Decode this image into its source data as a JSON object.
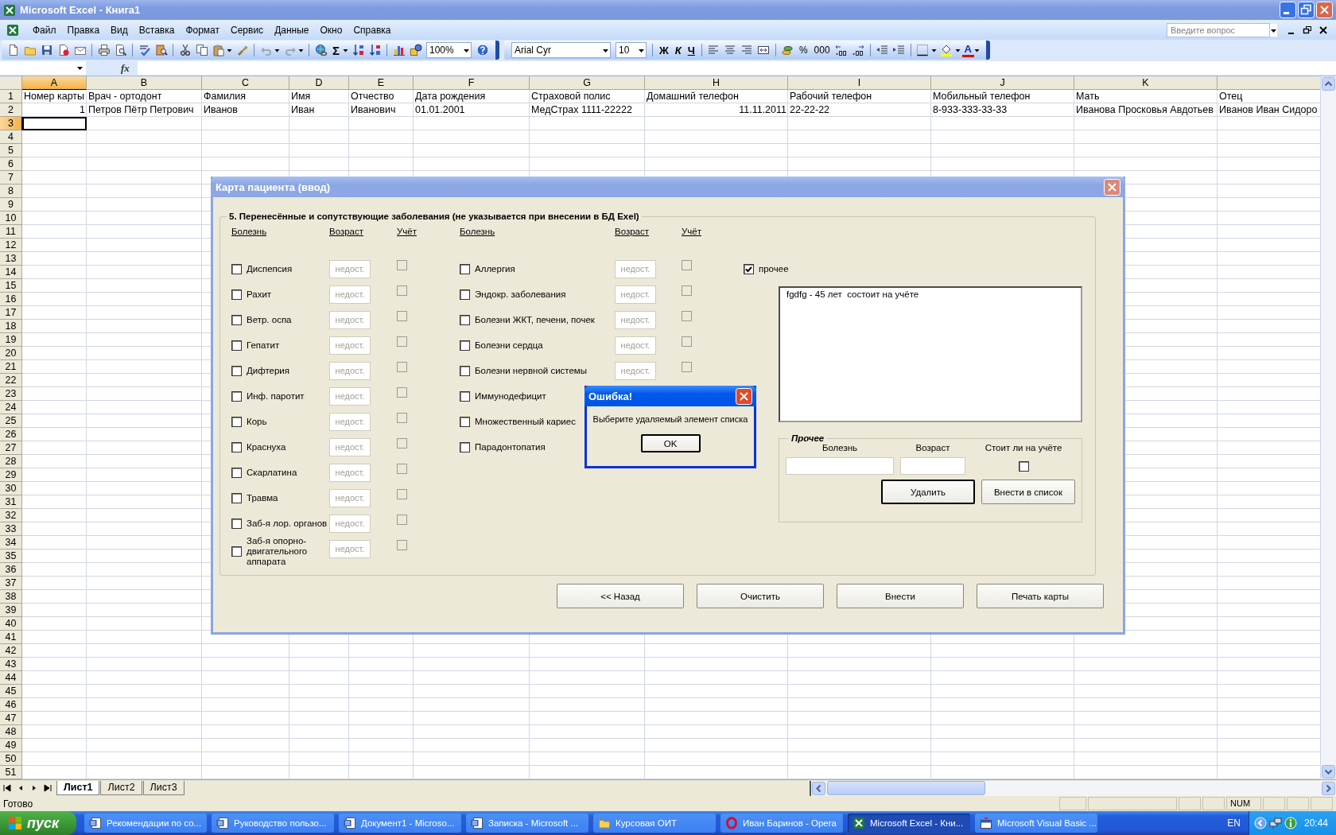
{
  "window": {
    "title": "Microsoft Excel - Книга1",
    "active": false
  },
  "menu": [
    "Файл",
    "Правка",
    "Вид",
    "Вставка",
    "Формат",
    "Сервис",
    "Данные",
    "Окно",
    "Справка"
  ],
  "help_search": {
    "placeholder": "Введите вопрос"
  },
  "toolbar": {
    "sum": "Σ",
    "zoom": "100%",
    "font": "Arial Cyr",
    "size": "10",
    "style_buttons": [
      {
        "label": "Ж",
        "kind": "bold"
      },
      {
        "label": "К",
        "kind": "italic"
      },
      {
        "label": "Ч",
        "kind": "underline"
      }
    ],
    "number_buttons": [
      "%",
      "000"
    ],
    "font_color": "A"
  },
  "formula_bar": {
    "fx": "fx"
  },
  "sheet": {
    "columns": [
      {
        "header": "A",
        "selected": true
      },
      {
        "header": "B",
        "selected": false
      },
      {
        "header": "C",
        "selected": false
      },
      {
        "header": "D",
        "selected": false
      },
      {
        "header": "E",
        "selected": false
      },
      {
        "header": "F",
        "selected": false
      },
      {
        "header": "G",
        "selected": false
      },
      {
        "header": "H",
        "selected": false
      },
      {
        "header": "I",
        "selected": false
      },
      {
        "header": "J",
        "selected": false
      },
      {
        "header": "K",
        "selected": false
      },
      {
        "selected": false
      }
    ],
    "rows": [
      {
        "header": "1",
        "selected": false,
        "cells": [
          {
            "text": "Номер карты",
            "kind": "text"
          },
          {
            "text": "Врач - ортодонт",
            "kind": "text"
          },
          {
            "text": "Фамилия",
            "kind": "text"
          },
          {
            "text": "Имя",
            "kind": "text"
          },
          {
            "text": "Отчество",
            "kind": "text"
          },
          {
            "text": "Дата рождения",
            "kind": "text"
          },
          {
            "text": "Страховой полис",
            "kind": "text"
          },
          {
            "text": "Домашний телефон",
            "kind": "text"
          },
          {
            "text": "Рабочий телефон",
            "kind": "text"
          },
          {
            "text": "Мобильный телефон",
            "kind": "text"
          },
          {
            "text": "Мать",
            "kind": "text"
          },
          {
            "text": "Отец",
            "kind": "text"
          }
        ]
      },
      {
        "header": "2",
        "selected": false,
        "cells": [
          {
            "text": "1",
            "kind": "number"
          },
          {
            "text": "Петров Пётр Петрович",
            "kind": "text"
          },
          {
            "text": "Иванов",
            "kind": "text"
          },
          {
            "text": "Иван",
            "kind": "text"
          },
          {
            "text": "Иванович",
            "kind": "text"
          },
          {
            "text": "01.01.2001",
            "kind": "text"
          },
          {
            "text": "МедСтрах 1111-22222",
            "kind": "text"
          },
          {
            "text": "11.11.2011",
            "kind": "number"
          },
          {
            "text": "22-22-22",
            "kind": "text"
          },
          {
            "text": "8-933-333-33-33",
            "kind": "text"
          },
          {
            "text": "Иванова Просковья Авдотьев",
            "kind": "text"
          },
          {
            "text": "Иванов Иван Сидоро",
            "kind": "text"
          }
        ]
      },
      {
        "header": "3",
        "selected": true
      },
      {
        "header": "4",
        "selected": false
      },
      {
        "header": "5",
        "selected": false
      },
      {
        "header": "6",
        "selected": false
      },
      {
        "header": "7",
        "selected": false
      },
      {
        "header": "8",
        "selected": false
      },
      {
        "header": "9",
        "selected": false
      },
      {
        "header": "10",
        "selected": false
      },
      {
        "header": "11",
        "selected": false
      },
      {
        "header": "12",
        "selected": false
      },
      {
        "header": "13",
        "selected": false
      },
      {
        "header": "14",
        "selected": false
      },
      {
        "header": "15",
        "selected": false
      },
      {
        "header": "16",
        "selected": false
      },
      {
        "header": "17",
        "selected": false
      },
      {
        "header": "18",
        "selected": false
      },
      {
        "header": "19",
        "selected": false
      },
      {
        "header": "20",
        "selected": false
      },
      {
        "header": "21",
        "selected": false
      },
      {
        "header": "22",
        "selected": false
      },
      {
        "header": "23",
        "selected": false
      },
      {
        "header": "24",
        "selected": false
      },
      {
        "header": "25",
        "selected": false
      },
      {
        "header": "26",
        "selected": false
      },
      {
        "header": "27",
        "selected": false
      },
      {
        "header": "28",
        "selected": false
      },
      {
        "header": "29",
        "selected": false
      },
      {
        "header": "30",
        "selected": false
      },
      {
        "header": "31",
        "selected": false
      },
      {
        "header": "32",
        "selected": false
      },
      {
        "header": "33",
        "selected": false
      },
      {
        "header": "34",
        "selected": false
      },
      {
        "header": "35",
        "selected": false
      },
      {
        "header": "36",
        "selected": false
      },
      {
        "header": "37",
        "selected": false
      },
      {
        "header": "38",
        "selected": false
      },
      {
        "header": "39",
        "selected": false
      },
      {
        "header": "40",
        "selected": false
      },
      {
        "header": "41",
        "selected": false
      },
      {
        "header": "42",
        "selected": false
      },
      {
        "header": "43",
        "selected": false
      },
      {
        "header": "44",
        "selected": false
      },
      {
        "header": "45",
        "selected": false
      },
      {
        "header": "46",
        "selected": false
      },
      {
        "header": "47",
        "selected": false
      },
      {
        "header": "48",
        "selected": false
      },
      {
        "header": "49",
        "selected": false
      },
      {
        "header": "50",
        "selected": false
      },
      {
        "header": "51",
        "selected": false
      }
    ]
  },
  "sheet_tabs": [
    {
      "label": "Лист1",
      "selected": true
    },
    {
      "label": "Лист2",
      "selected": false
    },
    {
      "label": "Лист3",
      "selected": false
    }
  ],
  "status_bar": {
    "text": "Готово",
    "indicators": [
      "NUM"
    ]
  },
  "patient_form": {
    "title": "Карта пациента (ввод)",
    "active": false,
    "legend": "5. Перенесённые и сопутствующие заболевания (не указывается при внесении в БД Exel)",
    "columns": [
      {
        "headers": [
          "Болезнь",
          "Возраст",
          "Учёт"
        ],
        "items": [
          {
            "label": "Диспепсия",
            "checked": false,
            "age": "недост.",
            "age_disabled": true,
            "registered": false
          },
          {
            "label": "Рахит",
            "checked": false,
            "age": "недост.",
            "age_disabled": true,
            "registered": false
          },
          {
            "label": "Ветр. оспа",
            "checked": false,
            "age": "недост.",
            "age_disabled": true,
            "registered": false
          },
          {
            "label": "Гепатит",
            "checked": false,
            "age": "недост.",
            "age_disabled": true,
            "registered": false
          },
          {
            "label": "Дифтерия",
            "checked": false,
            "age": "недост.",
            "age_disabled": true,
            "registered": false
          },
          {
            "label": "Инф. паротит",
            "checked": false,
            "age": "недост.",
            "age_disabled": true,
            "registered": false
          },
          {
            "label": "Корь",
            "checked": false,
            "age": "недост.",
            "age_disabled": true,
            "registered": false
          },
          {
            "label": "Краснуха",
            "checked": false,
            "age": "недост.",
            "age_disabled": true,
            "registered": false
          },
          {
            "label": "Скарлатина",
            "checked": false,
            "age": "недост.",
            "age_disabled": true,
            "registered": false
          },
          {
            "label": "Травма",
            "checked": false,
            "age": "недост.",
            "age_disabled": true,
            "registered": false
          },
          {
            "label": "Заб-я лор. органов",
            "checked": false,
            "age": "недост.",
            "age_disabled": true,
            "registered": false
          },
          {
            "label": "Заб-я опорно-двигательного аппарата",
            "checked": false,
            "age": "недост.",
            "age_disabled": true,
            "registered": false
          }
        ]
      },
      {
        "headers": [
          "Болезнь",
          "Возраст",
          "Учёт"
        ],
        "items": [
          {
            "label": "Аллергия",
            "checked": false,
            "age": "недост.",
            "age_disabled": true,
            "registered": false
          },
          {
            "label": "Эндокр. заболевания",
            "checked": false,
            "age": "недост.",
            "age_disabled": true,
            "registered": false
          },
          {
            "label": "Болезни ЖКТ, печени, почек",
            "checked": false,
            "age": "недост.",
            "age_disabled": true,
            "registered": false
          },
          {
            "label": "Болезни сердца",
            "checked": false,
            "age": "недост.",
            "age_disabled": true,
            "registered": false
          },
          {
            "label": "Болезни нервной системы",
            "checked": false,
            "age": "недост.",
            "age_disabled": true,
            "registered": false
          },
          {
            "label": "Иммунодефицит",
            "checked": false
          },
          {
            "label": "Множественный кариес",
            "checked": false
          },
          {
            "label": "Парадонтопатия",
            "checked": false
          }
        ]
      }
    ],
    "other": {
      "label": "прочее",
      "checked": true
    },
    "list": [
      "fgdfg - 45 лет  состоит на учёте"
    ],
    "other_frame": {
      "legend": "Прочее",
      "labels": [
        "Болезнь",
        "Возраст",
        "Стоит ли на учёте"
      ],
      "registered": false,
      "buttons": [
        {
          "label": "Удалить",
          "default": true
        },
        {
          "label": "Внести в список",
          "default": false
        }
      ]
    },
    "buttons": [
      "<< Назад",
      "Очистить",
      "Внести",
      "Печать карты"
    ]
  },
  "error_dialog": {
    "title": "Ошибка!",
    "active": true,
    "message": "Выберите удаляемый элемент списка",
    "button": "OK"
  },
  "taskbar": {
    "start": "пуск",
    "tasks": [
      {
        "label": "Рекомендации по со...",
        "kind": "word",
        "selected": false
      },
      {
        "label": "Руководство пользо...",
        "kind": "word",
        "selected": false
      },
      {
        "label": "Документ1 - Microso...",
        "kind": "word",
        "selected": false
      },
      {
        "label": "Записка - Microsoft ...",
        "kind": "word",
        "selected": false
      },
      {
        "label": "Курсовая ОИТ",
        "kind": "folder",
        "selected": false
      },
      {
        "label": "Иван Баринов - Opera",
        "kind": "opera",
        "selected": false
      },
      {
        "label": "Microsoft Excel - Кни...",
        "kind": "excel",
        "selected": true
      },
      {
        "label": "Microsoft Visual Basic ...",
        "kind": "vb",
        "selected": false
      }
    ],
    "language": "EN",
    "clock": "20:44"
  }
}
